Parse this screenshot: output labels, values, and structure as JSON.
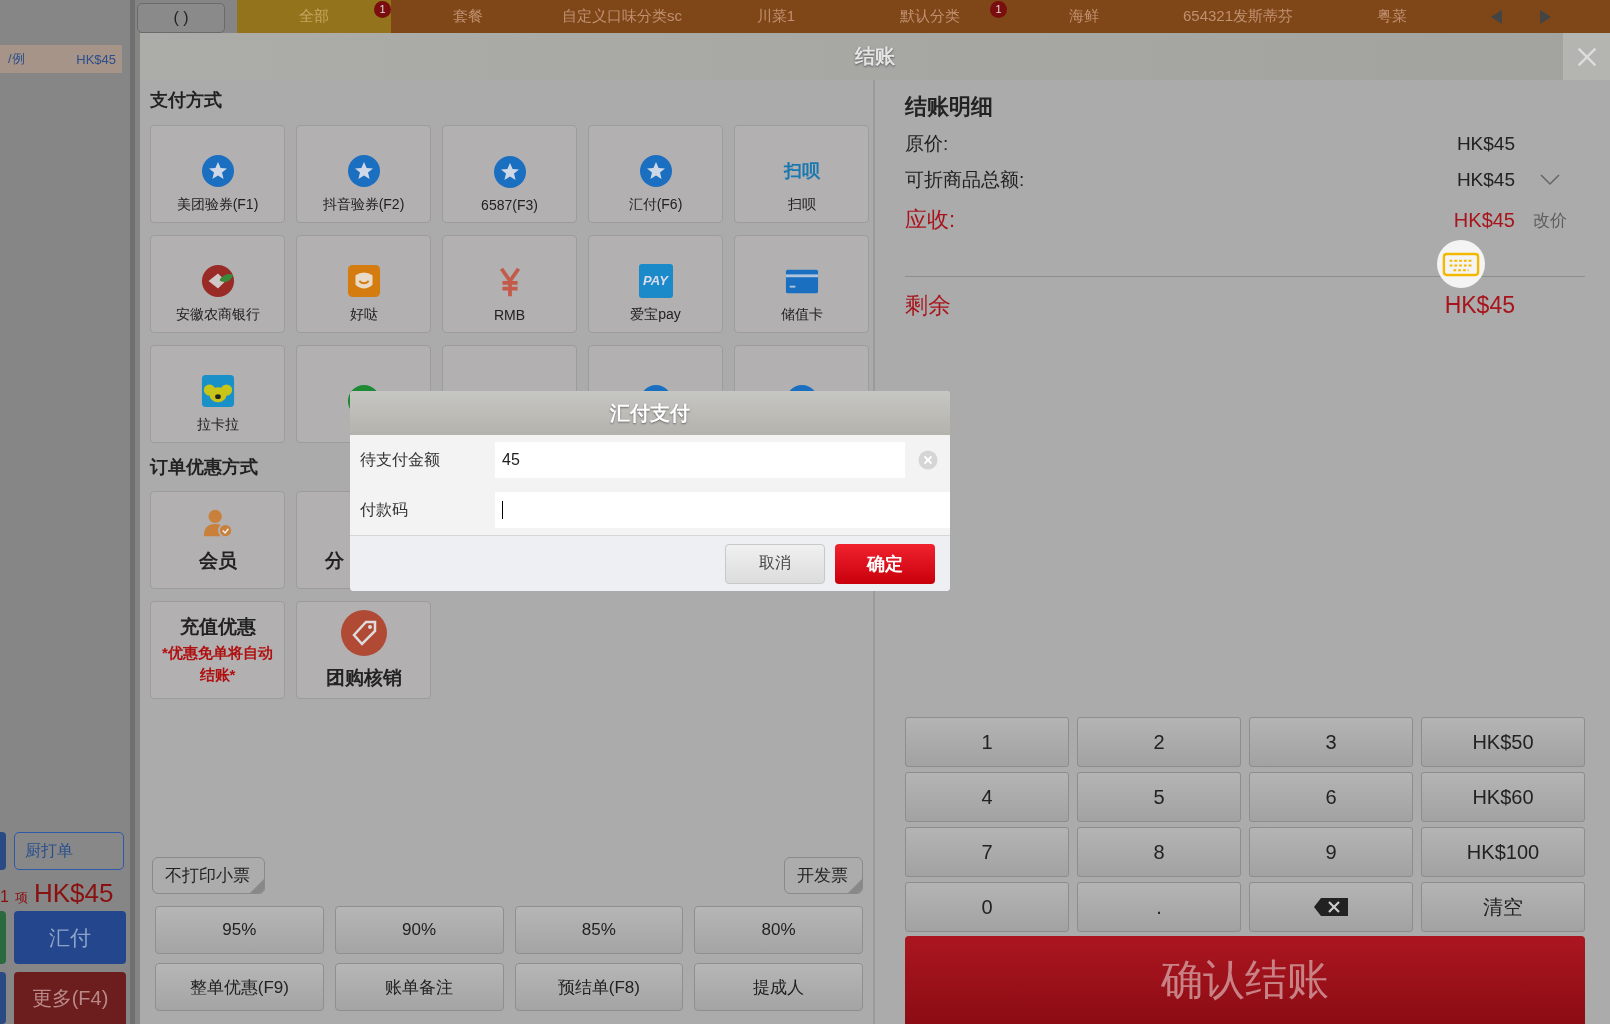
{
  "background": {
    "order_item": {
      "name": "/例",
      "price": "HK$45"
    },
    "top_button": "( )",
    "categories": [
      {
        "label": "全部",
        "selected": true,
        "badge": "1"
      },
      {
        "label": "套餐",
        "selected": false
      },
      {
        "label": "自定义口味分类sc",
        "selected": false
      },
      {
        "label": "川菜1",
        "selected": false
      },
      {
        "label": "默认分类",
        "selected": false,
        "badge": "1"
      },
      {
        "label": "海鲜",
        "selected": false
      },
      {
        "label": "654321发斯蒂芬",
        "selected": false
      },
      {
        "label": "粤菜",
        "selected": false
      }
    ],
    "kitchen_print": "厨打单",
    "summary": {
      "count": "1",
      "unit": "项",
      "total": "HK$45"
    },
    "pay_button": "汇付",
    "more_button": "更多(F4)"
  },
  "checkout": {
    "title": "结账",
    "payment_section": {
      "title": "支付方式",
      "methods": [
        {
          "label": "美团验券(F1)",
          "kind": "star"
        },
        {
          "label": "抖音验券(F2)",
          "kind": "star"
        },
        {
          "label": "6587(F3)",
          "kind": "star"
        },
        {
          "label": "汇付(F6)",
          "kind": "star"
        },
        {
          "label": "扫呗",
          "kind": "logo",
          "logo_text": "扫呗"
        },
        {
          "label": "安徽农商银行",
          "kind": "bank"
        },
        {
          "label": "好哒",
          "kind": "face"
        },
        {
          "label": "RMB",
          "kind": "yen"
        },
        {
          "label": "爱宝pay",
          "kind": "pay",
          "logo_text": "PAY"
        },
        {
          "label": "储值卡",
          "kind": "card"
        },
        {
          "label": "拉卡拉",
          "kind": "koala"
        },
        {
          "kind": "check"
        },
        {
          "kind": "ticket"
        },
        {
          "kind": "star"
        },
        {
          "kind": "star"
        }
      ]
    },
    "discount_section": {
      "title": "订单优惠方式",
      "items": [
        {
          "kind": "member",
          "label": "会员"
        },
        {
          "kind": "category",
          "label": "分"
        },
        {
          "kind": "blank"
        },
        {
          "kind": "blank"
        },
        {
          "kind": "blank"
        },
        {
          "kind": "recharge",
          "label": "充值优惠",
          "note": "*优惠免单将自动结账*"
        },
        {
          "kind": "groupbuy",
          "label": "团购核销"
        }
      ]
    },
    "print_receipt": "不打印小票",
    "invoice": "开发票",
    "discount_buttons": [
      "95%",
      "90%",
      "85%",
      "80%"
    ],
    "action_buttons": [
      "整单优惠(F9)",
      "账单备注",
      "预结单(F8)",
      "提成人"
    ],
    "details": {
      "title": "结账明细",
      "rows": [
        {
          "kind": "plain",
          "label": "原价:",
          "value": "HK$45"
        },
        {
          "kind": "expandable",
          "label": "可折商品总额:",
          "value": "HK$45",
          "expanded": false
        },
        {
          "kind": "due",
          "label": "应收:",
          "value": "HK$45",
          "action": "改价"
        }
      ],
      "remaining": {
        "label": "剩余",
        "value": "HK$45"
      }
    },
    "keypad": [
      {
        "kind": "digit",
        "label": "1"
      },
      {
        "kind": "digit",
        "label": "2"
      },
      {
        "kind": "digit",
        "label": "3"
      },
      {
        "kind": "amount",
        "label": "HK$50"
      },
      {
        "kind": "digit",
        "label": "4"
      },
      {
        "kind": "digit",
        "label": "5"
      },
      {
        "kind": "digit",
        "label": "6"
      },
      {
        "kind": "amount",
        "label": "HK$60"
      },
      {
        "kind": "digit",
        "label": "7"
      },
      {
        "kind": "digit",
        "label": "8"
      },
      {
        "kind": "digit",
        "label": "9"
      },
      {
        "kind": "amount",
        "label": "HK$100"
      },
      {
        "kind": "digit",
        "label": "0"
      },
      {
        "kind": "digit",
        "label": "."
      },
      {
        "kind": "backspace"
      },
      {
        "kind": "clear",
        "label": "清空"
      }
    ],
    "confirm": "确认结账"
  },
  "dialog": {
    "title": "汇付支付",
    "fields": [
      {
        "label": "待支付金额",
        "value": "45",
        "clearable": true,
        "focused": false
      },
      {
        "label": "付款码",
        "clearable": false,
        "focused": true
      }
    ],
    "buttons": [
      {
        "label": "取消",
        "kind": "secondary"
      },
      {
        "label": "确定",
        "kind": "primary"
      }
    ]
  }
}
